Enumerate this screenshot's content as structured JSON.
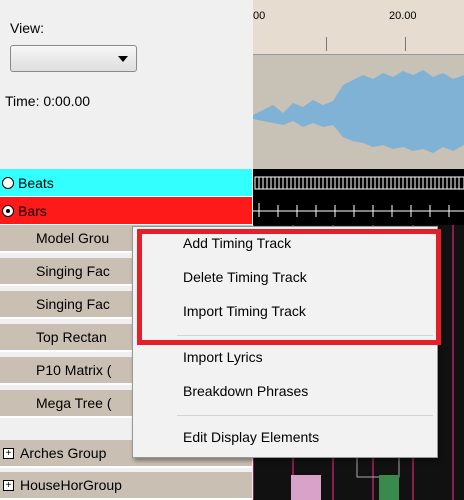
{
  "view": {
    "label": "View:",
    "selected": ""
  },
  "time": {
    "label": "Time: 0:00.00"
  },
  "ruler": {
    "ticks": [
      "00",
      "20.00"
    ]
  },
  "rows": {
    "beats": "Beats",
    "bars": "Bars",
    "models": [
      "Model Grou",
      "Singing Fac",
      "Singing Fac",
      "Top Rectan",
      "P10 Matrix (",
      "Mega Tree ("
    ],
    "groups": [
      "Arches Group",
      "HouseHorGroup"
    ]
  },
  "menu": {
    "items": [
      "Add Timing Track",
      "Delete Timing Track",
      "Import Timing Track",
      "Import Lyrics",
      "Breakdown Phrases",
      "Edit Display Elements"
    ]
  },
  "colors": {
    "beats": "#33ffff",
    "bars": "#ff1a1a",
    "highlight": "#e3202a",
    "waveform": "#7fb2d4"
  }
}
